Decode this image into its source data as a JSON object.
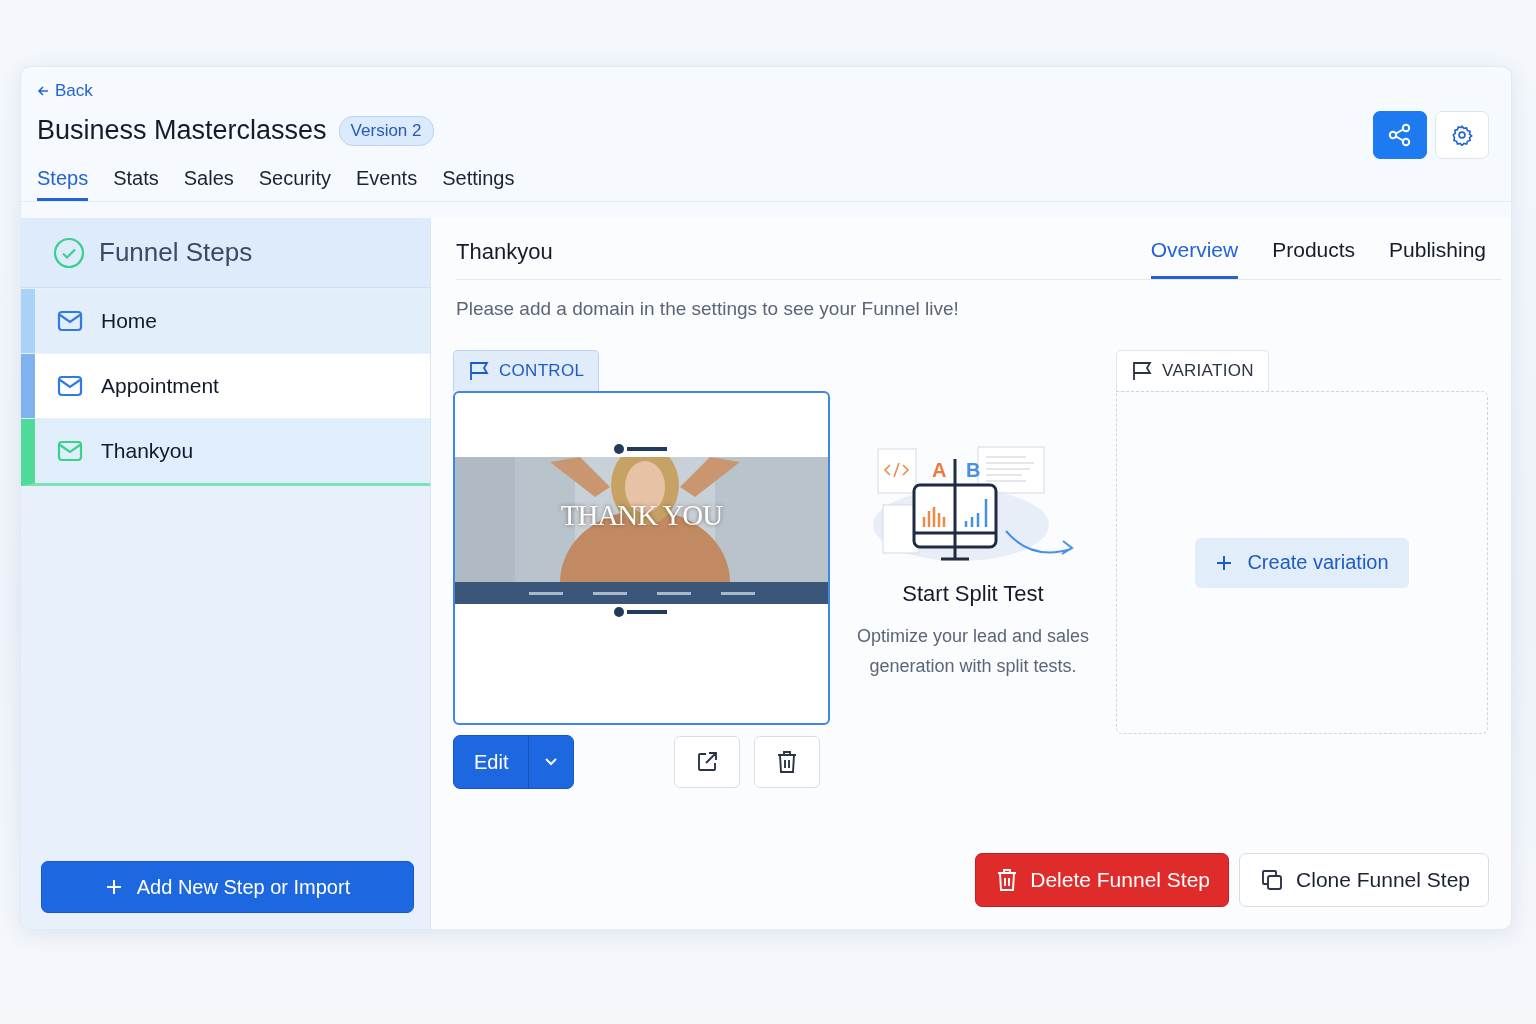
{
  "back": "Back",
  "title": "Business Masterclasses",
  "version": "Version 2",
  "tabs": [
    {
      "label": "Steps",
      "selected": true
    },
    {
      "label": "Stats",
      "selected": false
    },
    {
      "label": "Sales",
      "selected": false
    },
    {
      "label": "Security",
      "selected": false
    },
    {
      "label": "Events",
      "selected": false
    },
    {
      "label": "Settings",
      "selected": false
    }
  ],
  "sidebar": {
    "title": "Funnel Steps",
    "items": [
      {
        "label": "Home",
        "color": "#a9d2f6",
        "selected": false,
        "highlighted": false
      },
      {
        "label": "Appointment",
        "color": "#7fb2ef",
        "selected": false,
        "highlighted": true
      },
      {
        "label": "Thankyou",
        "color": "#4fd99a",
        "selected": true,
        "highlighted": false
      }
    ],
    "add_button": "Add New Step or Import"
  },
  "step": {
    "title": "Thankyou",
    "tabs": [
      {
        "label": "Overview",
        "selected": true
      },
      {
        "label": "Products",
        "selected": false
      },
      {
        "label": "Publishing",
        "selected": false
      }
    ],
    "notice": "Please add a domain in the settings to see your Funnel live!",
    "control": {
      "label": "CONTROL",
      "preview_heading": "THANK YOU",
      "edit_button": "Edit"
    },
    "split_test": {
      "chart_labels": [
        "A",
        "B"
      ],
      "title": "Start Split Test",
      "description": "Optimize your lead and sales generation with split tests."
    },
    "variation": {
      "label": "VARIATION",
      "create_button": "Create variation"
    },
    "delete_button": "Delete Funnel Step",
    "clone_button": "Clone Funnel Step"
  }
}
